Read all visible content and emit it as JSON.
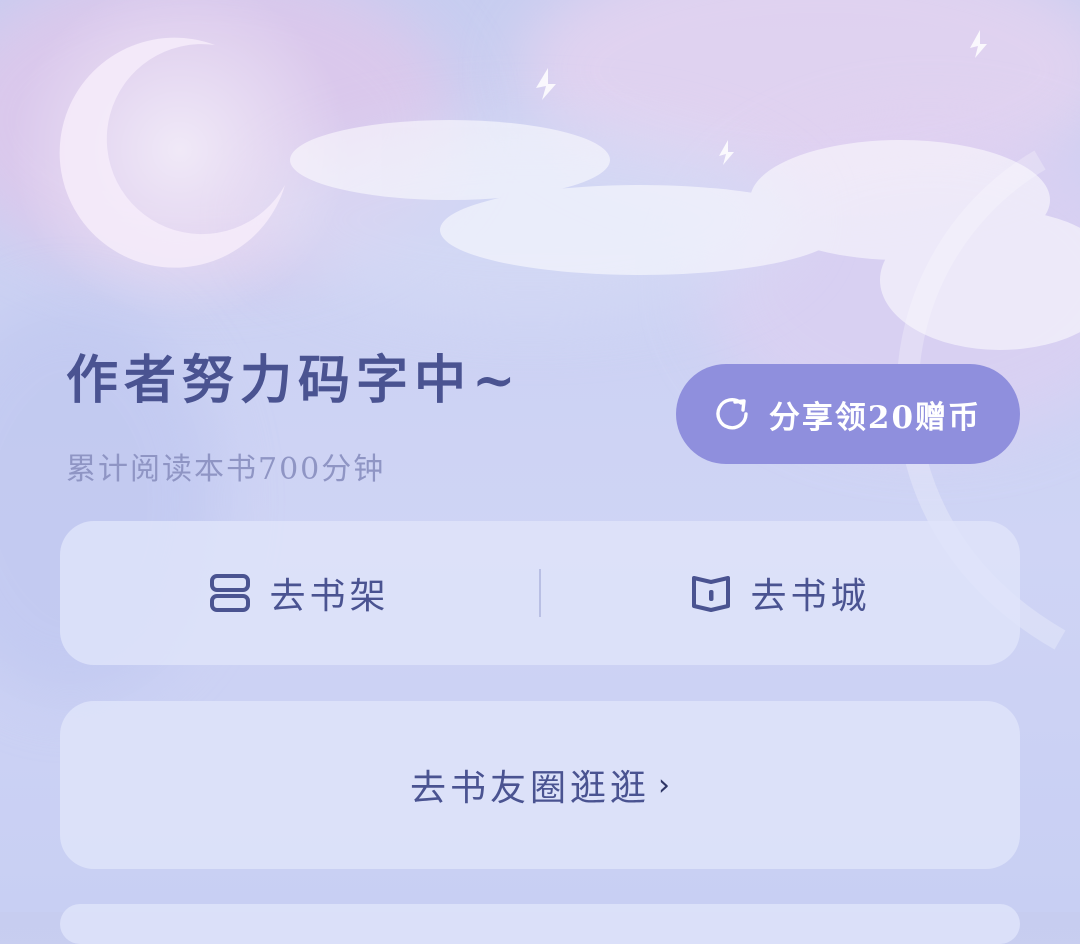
{
  "header": {
    "title": "作者努力码字中~",
    "reading_stat": "累计阅读本书700分钟"
  },
  "share": {
    "label": "分享领20赠币",
    "icon": "refresh-share-icon"
  },
  "nav": {
    "bookshelf": {
      "label": "去书架",
      "icon": "bookshelf-icon"
    },
    "bookstore": {
      "label": "去书城",
      "icon": "book-icon"
    }
  },
  "circle": {
    "label": "去书友圈逛逛",
    "icon": "chevron-right-icon"
  },
  "colors": {
    "accent": "#8f8fdd",
    "text_primary": "#4a5391",
    "text_secondary": "#8f95c4"
  }
}
